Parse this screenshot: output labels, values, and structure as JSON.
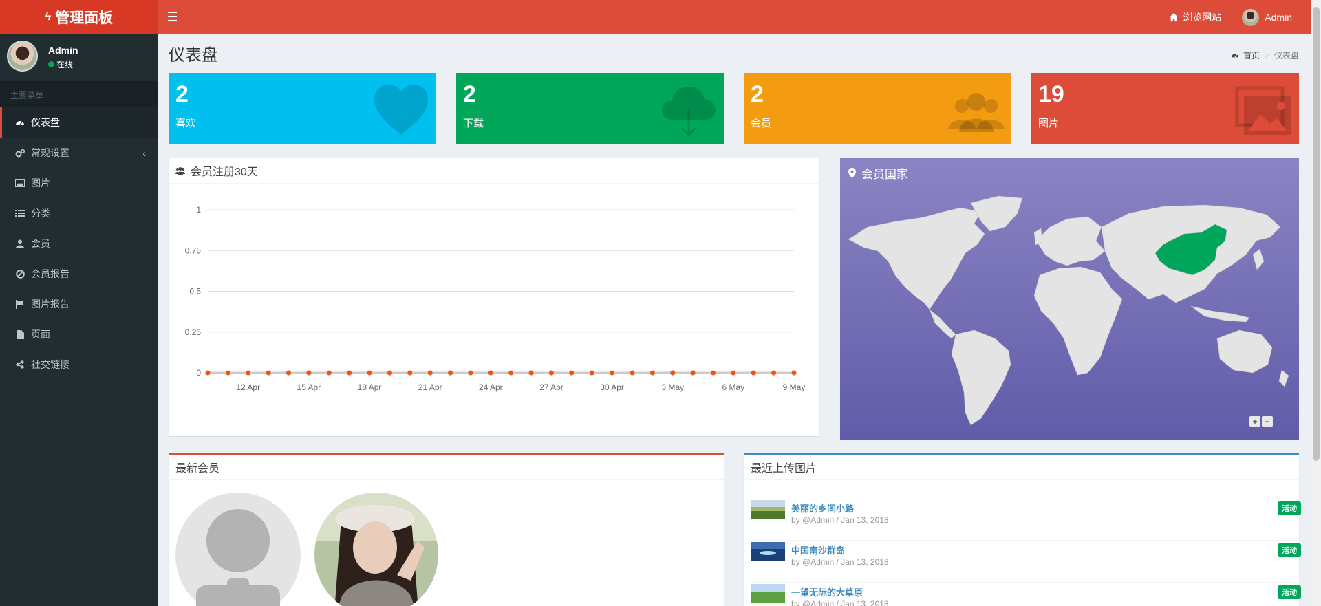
{
  "app": {
    "title": "管理面板"
  },
  "navbar": {
    "browse_label": "浏览网站",
    "user_label": "Admin"
  },
  "sidebar": {
    "user": {
      "name": "Admin",
      "status": "在线"
    },
    "header": "主要菜单",
    "items": [
      {
        "label": "仪表盘",
        "icon": "dashboard-icon",
        "active": true
      },
      {
        "label": "常规设置",
        "icon": "cogs-icon"
      },
      {
        "label": "图片",
        "icon": "image-icon"
      },
      {
        "label": "分类",
        "icon": "list-icon"
      },
      {
        "label": "会员",
        "icon": "user-icon"
      },
      {
        "label": "会员报告",
        "icon": "ban-icon"
      },
      {
        "label": "图片报告",
        "icon": "flag-icon"
      },
      {
        "label": "页面",
        "icon": "file-icon"
      },
      {
        "label": "社交链接",
        "icon": "share-icon"
      }
    ]
  },
  "page": {
    "title": "仪表盘"
  },
  "breadcrumb": {
    "home": "首页",
    "current": "仪表盘"
  },
  "stats": [
    {
      "value": "2",
      "label": "喜欢",
      "color": "#00c0ef",
      "icon": "heart-icon"
    },
    {
      "value": "2",
      "label": "下载",
      "color": "#00a65a",
      "icon": "cloud-download-icon"
    },
    {
      "value": "2",
      "label": "会员",
      "color": "#f39c12",
      "icon": "users-icon"
    },
    {
      "value": "19",
      "label": "图片",
      "color": "#dd4b39",
      "icon": "images-icon"
    }
  ],
  "chart_box": {
    "title": "会员注册30天"
  },
  "chart_data": {
    "type": "line",
    "title": "",
    "xlabel": "",
    "ylabel": "",
    "ylim": [
      0,
      1
    ],
    "yticks": [
      "0",
      "0.25",
      "0.5",
      "0.75",
      "1"
    ],
    "xticks": [
      "12 Apr",
      "15 Apr",
      "18 Apr",
      "21 Apr",
      "24 Apr",
      "27 Apr",
      "30 Apr",
      "3 May",
      "6 May",
      "9 May"
    ],
    "x": [
      "10 Apr",
      "11 Apr",
      "12 Apr",
      "13 Apr",
      "14 Apr",
      "15 Apr",
      "16 Apr",
      "17 Apr",
      "18 Apr",
      "19 Apr",
      "20 Apr",
      "21 Apr",
      "22 Apr",
      "23 Apr",
      "24 Apr",
      "25 Apr",
      "26 Apr",
      "27 Apr",
      "28 Apr",
      "29 Apr",
      "30 Apr",
      "1 May",
      "2 May",
      "3 May",
      "4 May",
      "5 May",
      "6 May",
      "7 May",
      "8 May",
      "9 May"
    ],
    "series": [
      {
        "values": [
          0,
          0,
          0,
          0,
          0,
          0,
          0,
          0,
          0,
          0,
          0,
          0,
          0,
          0,
          0,
          0,
          0,
          0,
          0,
          0,
          0,
          0,
          0,
          0,
          0,
          0,
          0,
          0,
          0,
          0
        ],
        "color": "#f56954"
      }
    ]
  },
  "map_box": {
    "title": "会员国家",
    "zoom_in": "+",
    "zoom_out": "−",
    "highlight_country": "China",
    "highlight_color": "#00a65a"
  },
  "members_box": {
    "title": "最新会员"
  },
  "images_box": {
    "title": "最近上传图片",
    "items": [
      {
        "title": "美丽的乡间小路",
        "meta": "by @Admin / Jan 13, 2018",
        "badge": "活动"
      },
      {
        "title": "中国南沙群岛",
        "meta": "by @Admin / Jan 13, 2018",
        "badge": "活动"
      },
      {
        "title": "一望无际的大草原",
        "meta": "by @Admin / Jan 13, 2018",
        "badge": "活动"
      }
    ]
  }
}
